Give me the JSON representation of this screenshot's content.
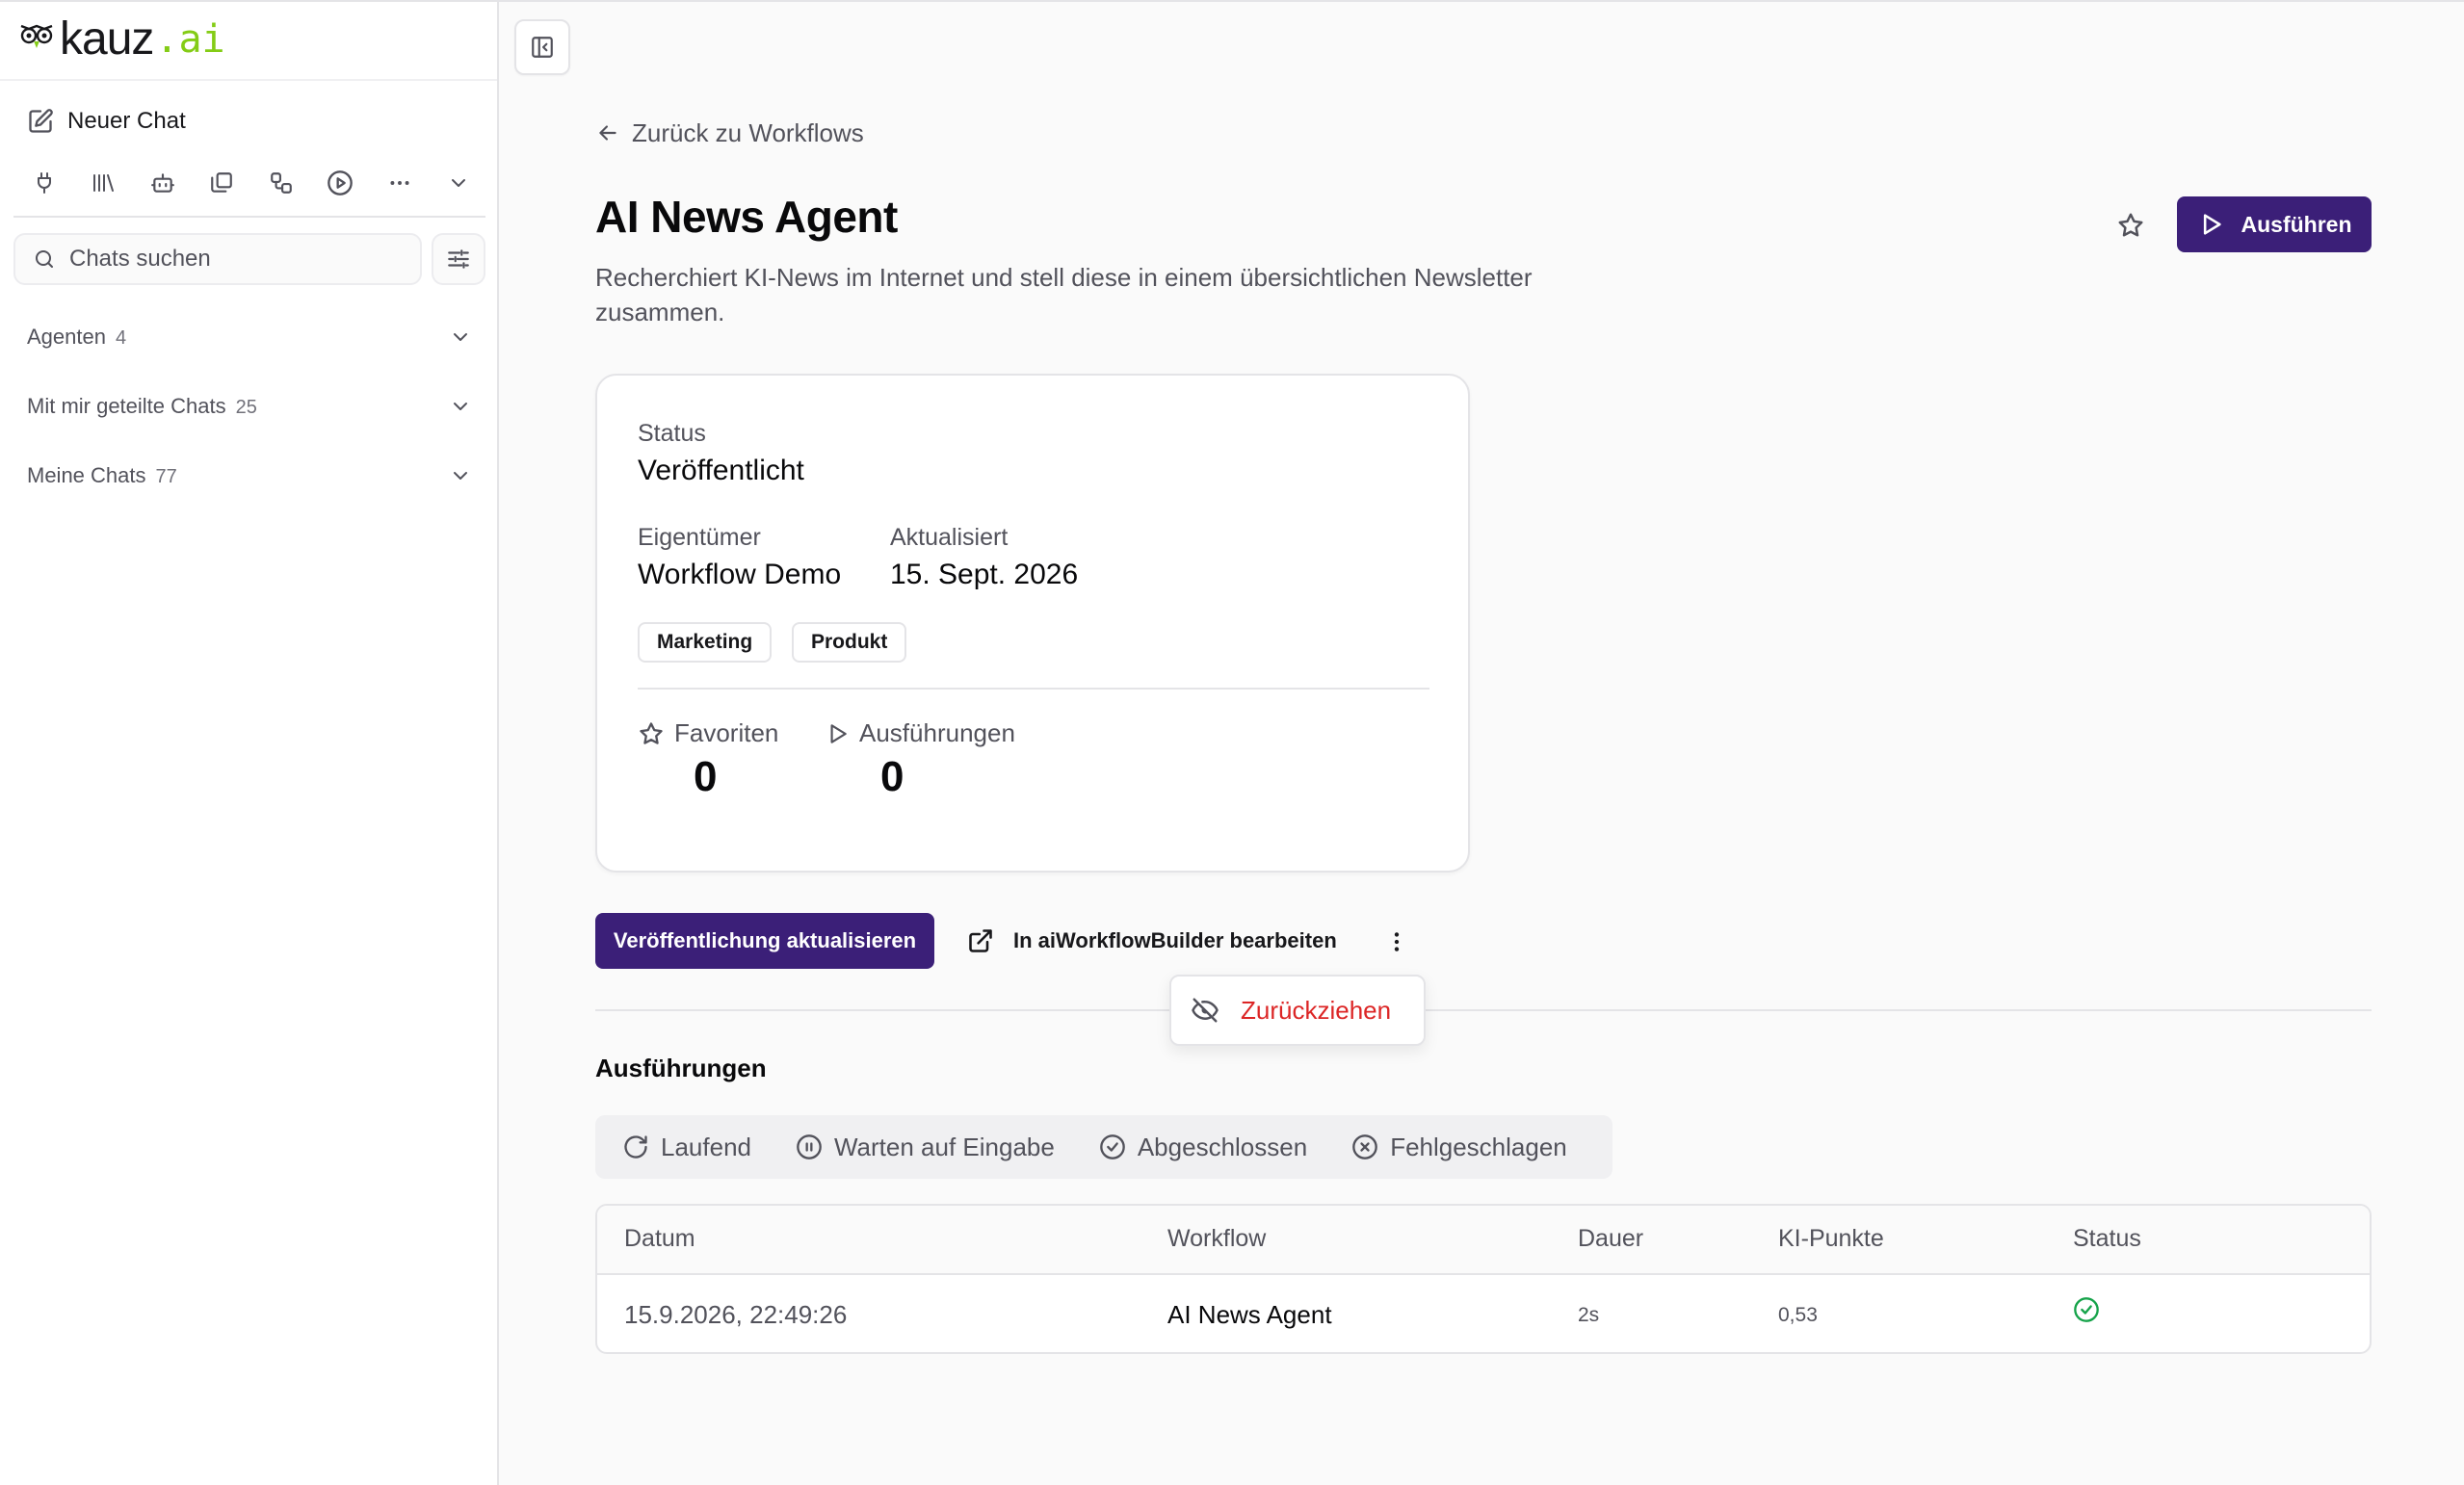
{
  "brand": {
    "name": "kauz",
    "tld": ".ai",
    "accent": "#84cc16"
  },
  "sidebar": {
    "new_chat": "Neuer Chat",
    "tools": [
      "plug-icon",
      "library-icon",
      "bot-icon",
      "files-icon",
      "workflow-icon",
      "play-icon",
      "more-icon",
      "chevron-down-icon"
    ],
    "search_placeholder": "Chats suchen",
    "sections": [
      {
        "label": "Agenten",
        "count": "4"
      },
      {
        "label": "Mit mir geteilte Chats",
        "count": "25"
      },
      {
        "label": "Meine Chats",
        "count": "77"
      }
    ]
  },
  "main": {
    "back_link": "Zurück zu Workflows",
    "title": "AI News Agent",
    "description": "Recherchiert KI-News im Internet und stell diese in einem übersichtlichen Newsletter zusammen.",
    "run_button": "Ausführen",
    "primary_color": "#3b1f78",
    "card": {
      "status_label": "Status",
      "status_value": "Veröffentlicht",
      "owner_label": "Eigentümer",
      "owner_value": "Workflow Demo",
      "updated_label": "Aktualisiert",
      "updated_value": "15. Sept. 2026",
      "tags": [
        "Marketing",
        "Produkt"
      ],
      "favorites_label": "Favoriten",
      "favorites_value": "0",
      "runs_label": "Ausführungen",
      "runs_value": "0"
    },
    "update_button": "Veröffentlichung aktualisieren",
    "edit_button": "In aiWorkflowBuilder bearbeiten",
    "dropdown": {
      "withdraw": "Zurückziehen",
      "danger_color": "#dc2626"
    },
    "runs_section": {
      "title": "Ausführungen",
      "filters": [
        "Laufend",
        "Warten auf Eingabe",
        "Abgeschlossen",
        "Fehlgeschlagen"
      ],
      "columns": [
        "Datum",
        "Workflow",
        "Dauer",
        "KI-Punkte",
        "Status"
      ],
      "rows": [
        {
          "date": "15.9.2026, 22:49:26",
          "workflow": "AI News Agent",
          "duration": "2s",
          "points": "0,53",
          "status": "success",
          "status_color": "#16a34a"
        }
      ]
    }
  }
}
